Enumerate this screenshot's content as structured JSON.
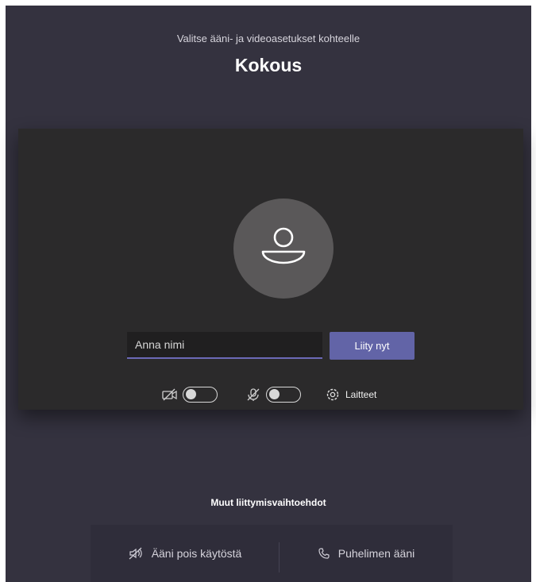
{
  "header": {
    "subtitle": "Valitse ääni- ja videoasetukset kohteelle",
    "title": "Kokous"
  },
  "prejoin": {
    "name_placeholder": "Anna nimi",
    "name_value": "",
    "join_label": "Liity nyt",
    "camera_toggle": {
      "icon": "camera-off-icon",
      "on": false
    },
    "mic_toggle": {
      "icon": "mic-off-icon",
      "on": false
    },
    "devices_label": "Laitteet",
    "devices_icon": "gear-icon"
  },
  "other_options": {
    "heading": "Muut liittymisvaihtoehdot",
    "items": [
      {
        "label": "Ääni pois käytöstä",
        "icon": "speaker-off-icon"
      },
      {
        "label": "Puhelimen ääni",
        "icon": "phone-icon"
      }
    ]
  },
  "colors": {
    "background": "#34323f",
    "card": "#2b2a2b",
    "accent": "#6264a7"
  }
}
